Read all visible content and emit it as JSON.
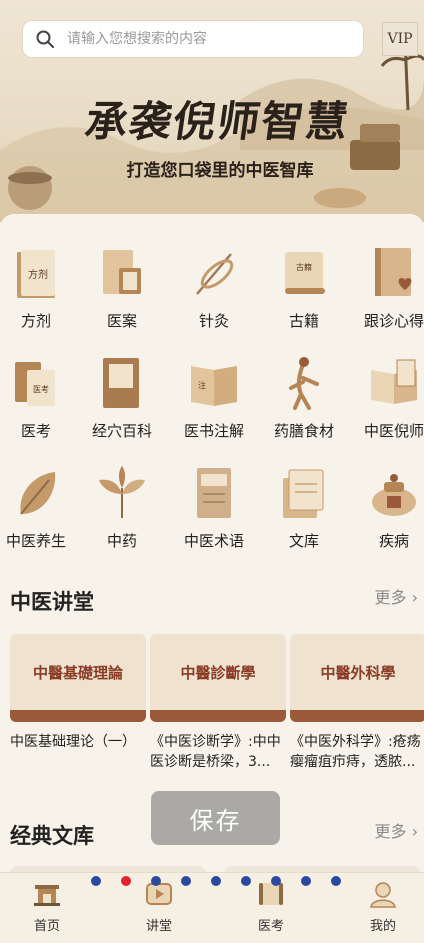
{
  "search": {
    "placeholder": "请输入您想搜索的内容"
  },
  "vip": {
    "label": "VIP"
  },
  "banner": {
    "title": "承袭倪师智慧",
    "subtitle": "打造您口袋里的中医智库"
  },
  "categories": [
    {
      "label": "方剂",
      "icon": "book-fangji-icon"
    },
    {
      "label": "医案",
      "icon": "book-yian-icon"
    },
    {
      "label": "针灸",
      "icon": "acupuncture-needle-icon"
    },
    {
      "label": "古籍",
      "icon": "scroll-book-icon"
    },
    {
      "label": "跟诊心得",
      "icon": "heart-book-icon"
    },
    {
      "label": "医考",
      "icon": "exam-book-icon"
    },
    {
      "label": "经穴百科",
      "icon": "encyclopedia-book-icon"
    },
    {
      "label": "医书注解",
      "icon": "annotated-book-icon"
    },
    {
      "label": "药膳食材",
      "icon": "ginseng-icon"
    },
    {
      "label": "中医倪师",
      "icon": "open-book-icon"
    },
    {
      "label": "中医养生",
      "icon": "leaf-icon"
    },
    {
      "label": "中药",
      "icon": "herb-icon"
    },
    {
      "label": "中医术语",
      "icon": "terminology-book-icon"
    },
    {
      "label": "文库",
      "icon": "library-doc-icon"
    },
    {
      "label": "疾病",
      "icon": "medicine-pot-icon"
    }
  ],
  "lecture_section": {
    "title": "中医讲堂",
    "more": "更多",
    "items": [
      {
        "title": "中医基础理论（一）",
        "thumb_title": "中醫基礎理論"
      },
      {
        "title": "《中医诊断学》:中中医诊断是桥梁，3...",
        "thumb_title": "中醫診斷學"
      },
      {
        "title": "《中医外科学》:疮疡瘿瘤疽疖痔，透脓...",
        "thumb_title": "中醫外科學"
      }
    ]
  },
  "library_section": {
    "title": "经典文库",
    "more": "更多"
  },
  "save_button": {
    "label": "保存"
  },
  "tabbar": [
    {
      "label": "首页",
      "icon": "home-pavilion-icon"
    },
    {
      "label": "讲堂",
      "icon": "play-video-icon"
    },
    {
      "label": "医考",
      "icon": "scroll-exam-icon"
    },
    {
      "label": "我的",
      "icon": "profile-icon"
    }
  ],
  "colors": {
    "accent": "#9a5a3a",
    "title_red": "#8a3b25",
    "dot_blue": "#2a4aa0",
    "dot_red": "#e0232f"
  }
}
